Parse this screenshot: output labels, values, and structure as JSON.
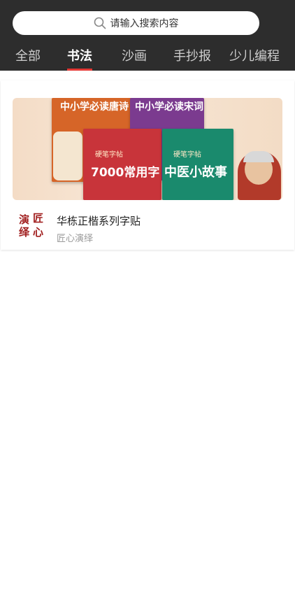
{
  "search": {
    "placeholder": "请输入搜索内容"
  },
  "tabs": [
    {
      "label": "全部",
      "active": false
    },
    {
      "label": "书法",
      "active": true
    },
    {
      "label": "沙画",
      "active": false
    },
    {
      "label": "手抄报",
      "active": false
    },
    {
      "label": "少儿编程",
      "active": false
    }
  ],
  "card": {
    "banner": {
      "book1_title": "中小学必读唐诗",
      "book2_title": "中小学必读宋词",
      "book3_tag": "硬笔字帖",
      "book3_title": "7000常用字",
      "book4_tag": "硬笔字帖",
      "book4_title": "中医小故事"
    },
    "logo_chars": [
      "演",
      "匠",
      "绎",
      "心"
    ],
    "title": "华栋正楷系列字贴",
    "subtitle": "匠心演绎"
  },
  "colors": {
    "header_bg": "#2d2d2d",
    "tab_indicator": "#e53935",
    "tab_active": "#ffffff",
    "tab_inactive": "#cfcfcf"
  }
}
